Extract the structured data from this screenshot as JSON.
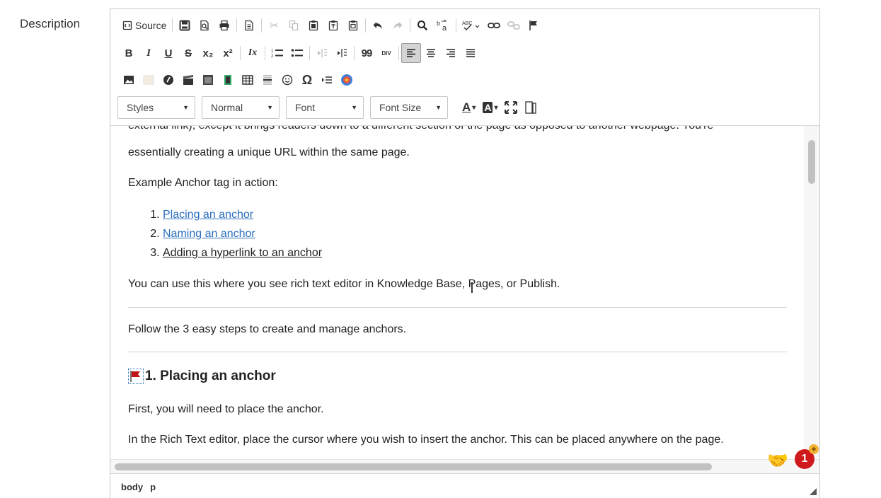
{
  "field": {
    "label": "Description"
  },
  "toolbar": {
    "source_label": "Source",
    "combos": {
      "styles": "Styles",
      "format": "Normal",
      "font": "Font",
      "font_size": "Font Size"
    },
    "icons": [
      "source-icon",
      "save-icon",
      "preview-icon",
      "print-icon",
      "templates-icon",
      "cut-icon",
      "copy-icon",
      "paste-icon",
      "paste-text-icon",
      "paste-word-icon",
      "undo-icon",
      "redo-icon",
      "find-icon",
      "replace-icon",
      "spellcheck-icon",
      "link-icon",
      "unlink-icon",
      "anchor-icon",
      "bold-icon",
      "italic-icon",
      "underline-icon",
      "strike-icon",
      "subscript-icon",
      "superscript-icon",
      "remove-format-icon",
      "numbered-list-icon",
      "bulleted-list-icon",
      "outdent-icon",
      "indent-icon",
      "blockquote-icon",
      "div-icon",
      "align-left-icon",
      "align-center-icon",
      "align-right-icon",
      "justify-icon",
      "image-icon",
      "flash-icon",
      "embed-icon",
      "video-icon",
      "iframe-icon",
      "media-icon",
      "table-icon",
      "horizontal-rule-icon",
      "smiley-icon",
      "special-char-icon",
      "page-break-icon",
      "widget-icon",
      "text-color-icon",
      "bg-color-icon",
      "maximize-icon",
      "show-blocks-icon"
    ],
    "text_glyphs": {
      "bold": "B",
      "italic": "I",
      "underline": "U",
      "strike": "S",
      "sub": "x₂",
      "sup": "x²",
      "remove_format": "Ix",
      "quote": "99",
      "div": "DIV",
      "omega": "Ω",
      "text_color": "A",
      "bg_color": "A"
    }
  },
  "content": {
    "cut_line": "external link), except it brings readers down to a different section of the page as opposed to another webpage. You're",
    "p1": "essentially creating a unique URL within the same page.",
    "p2": "Example Anchor tag in action:",
    "list": [
      "Placing an anchor",
      "Naming an anchor",
      "Adding a hyperlink to an anchor"
    ],
    "p3": "You can use this where you see rich text editor in Knowledge Base, Pages, or Publish.",
    "p4": "Follow the 3 easy steps to create and manage anchors.",
    "h1": "1. Placing an anchor",
    "p5": "First, you will need to place the anchor.",
    "p6": "In the Rich Text editor, place the cursor where you wish to insert the anchor. This can be placed anywhere on the page."
  },
  "statusbar": {
    "path": [
      "body",
      "p"
    ]
  },
  "notifications": {
    "count": "1",
    "plus": "+"
  },
  "colors": {
    "link": "#2a6ebb",
    "badge": "#d0191c",
    "badge_plus": "#f2b233"
  }
}
